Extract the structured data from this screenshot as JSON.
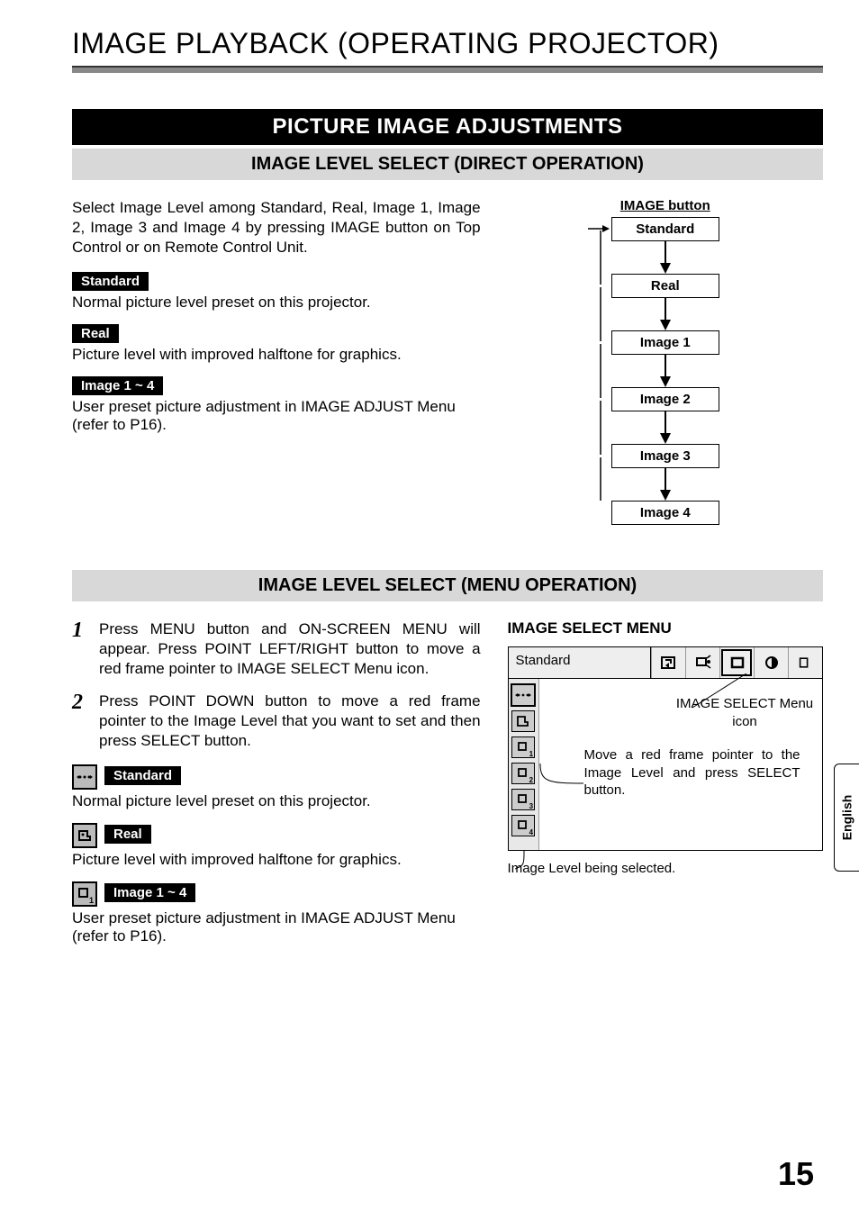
{
  "page_title": "IMAGE PLAYBACK (OPERATING PROJECTOR)",
  "section_header": "PICTURE IMAGE ADJUSTMENTS",
  "direct": {
    "heading": "IMAGE LEVEL SELECT (DIRECT OPERATION)",
    "intro": "Select Image Level among Standard, Real, Image 1, Image 2, Image 3 and Image 4 by pressing IMAGE button on Top Control or on Remote Control Unit.",
    "items": [
      {
        "tag": "Standard",
        "desc": "Normal picture level preset on this projector."
      },
      {
        "tag": "Real",
        "desc": "Picture level with improved halftone for graphics."
      },
      {
        "tag": "Image 1 ~ 4",
        "desc": "User preset picture adjustment in IMAGE ADJUST Menu (refer to P16)."
      }
    ],
    "diagram": {
      "title": "IMAGE button",
      "levels": [
        "Standard",
        "Real",
        "Image 1",
        "Image 2",
        "Image 3",
        "Image 4"
      ]
    }
  },
  "menu": {
    "heading": "IMAGE LEVEL SELECT (MENU OPERATION)",
    "steps": [
      "Press MENU button and ON-SCREEN MENU will appear.  Press POINT LEFT/RIGHT button to move a red frame pointer to IMAGE SELECT Menu icon.",
      "Press POINT DOWN button to move a red frame pointer to the Image Level that you want to set and then press SELECT button."
    ],
    "items": [
      {
        "tag": "Standard",
        "desc": "Normal picture level preset on this projector.",
        "icon": "standard-icon"
      },
      {
        "tag": "Real",
        "desc": "Picture level with improved halftone for graphics.",
        "icon": "real-icon"
      },
      {
        "tag": "Image 1 ~ 4",
        "desc": "User preset picture adjustment in IMAGE ADJUST Menu (refer to P16).",
        "icon": "image1-icon"
      }
    ],
    "panel_heading": "IMAGE SELECT MENU",
    "osd_selected": "Standard",
    "icon_label": "IMAGE SELECT Menu icon",
    "pointer_text": "Move a red frame pointer to the Image Level and press SELECT button.",
    "caption": "Image Level being selected."
  },
  "page_number": "15",
  "language_tab": "English"
}
